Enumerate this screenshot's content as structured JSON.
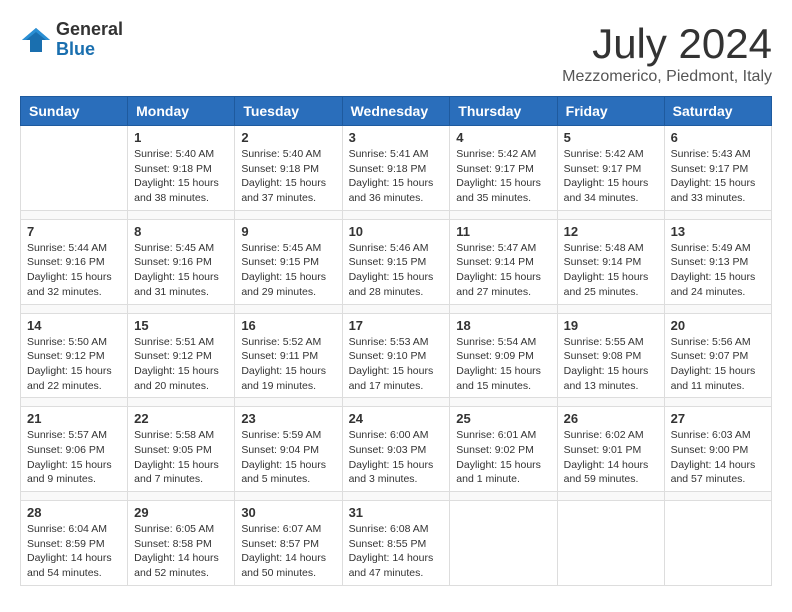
{
  "header": {
    "logo_general": "General",
    "logo_blue": "Blue",
    "month": "July 2024",
    "location": "Mezzomerico, Piedmont, Italy"
  },
  "columns": [
    "Sunday",
    "Monday",
    "Tuesday",
    "Wednesday",
    "Thursday",
    "Friday",
    "Saturday"
  ],
  "weeks": [
    [
      {
        "day": "",
        "text": ""
      },
      {
        "day": "1",
        "text": "Sunrise: 5:40 AM\nSunset: 9:18 PM\nDaylight: 15 hours\nand 38 minutes."
      },
      {
        "day": "2",
        "text": "Sunrise: 5:40 AM\nSunset: 9:18 PM\nDaylight: 15 hours\nand 37 minutes."
      },
      {
        "day": "3",
        "text": "Sunrise: 5:41 AM\nSunset: 9:18 PM\nDaylight: 15 hours\nand 36 minutes."
      },
      {
        "day": "4",
        "text": "Sunrise: 5:42 AM\nSunset: 9:17 PM\nDaylight: 15 hours\nand 35 minutes."
      },
      {
        "day": "5",
        "text": "Sunrise: 5:42 AM\nSunset: 9:17 PM\nDaylight: 15 hours\nand 34 minutes."
      },
      {
        "day": "6",
        "text": "Sunrise: 5:43 AM\nSunset: 9:17 PM\nDaylight: 15 hours\nand 33 minutes."
      }
    ],
    [
      {
        "day": "7",
        "text": "Sunrise: 5:44 AM\nSunset: 9:16 PM\nDaylight: 15 hours\nand 32 minutes."
      },
      {
        "day": "8",
        "text": "Sunrise: 5:45 AM\nSunset: 9:16 PM\nDaylight: 15 hours\nand 31 minutes."
      },
      {
        "day": "9",
        "text": "Sunrise: 5:45 AM\nSunset: 9:15 PM\nDaylight: 15 hours\nand 29 minutes."
      },
      {
        "day": "10",
        "text": "Sunrise: 5:46 AM\nSunset: 9:15 PM\nDaylight: 15 hours\nand 28 minutes."
      },
      {
        "day": "11",
        "text": "Sunrise: 5:47 AM\nSunset: 9:14 PM\nDaylight: 15 hours\nand 27 minutes."
      },
      {
        "day": "12",
        "text": "Sunrise: 5:48 AM\nSunset: 9:14 PM\nDaylight: 15 hours\nand 25 minutes."
      },
      {
        "day": "13",
        "text": "Sunrise: 5:49 AM\nSunset: 9:13 PM\nDaylight: 15 hours\nand 24 minutes."
      }
    ],
    [
      {
        "day": "14",
        "text": "Sunrise: 5:50 AM\nSunset: 9:12 PM\nDaylight: 15 hours\nand 22 minutes."
      },
      {
        "day": "15",
        "text": "Sunrise: 5:51 AM\nSunset: 9:12 PM\nDaylight: 15 hours\nand 20 minutes."
      },
      {
        "day": "16",
        "text": "Sunrise: 5:52 AM\nSunset: 9:11 PM\nDaylight: 15 hours\nand 19 minutes."
      },
      {
        "day": "17",
        "text": "Sunrise: 5:53 AM\nSunset: 9:10 PM\nDaylight: 15 hours\nand 17 minutes."
      },
      {
        "day": "18",
        "text": "Sunrise: 5:54 AM\nSunset: 9:09 PM\nDaylight: 15 hours\nand 15 minutes."
      },
      {
        "day": "19",
        "text": "Sunrise: 5:55 AM\nSunset: 9:08 PM\nDaylight: 15 hours\nand 13 minutes."
      },
      {
        "day": "20",
        "text": "Sunrise: 5:56 AM\nSunset: 9:07 PM\nDaylight: 15 hours\nand 11 minutes."
      }
    ],
    [
      {
        "day": "21",
        "text": "Sunrise: 5:57 AM\nSunset: 9:06 PM\nDaylight: 15 hours\nand 9 minutes."
      },
      {
        "day": "22",
        "text": "Sunrise: 5:58 AM\nSunset: 9:05 PM\nDaylight: 15 hours\nand 7 minutes."
      },
      {
        "day": "23",
        "text": "Sunrise: 5:59 AM\nSunset: 9:04 PM\nDaylight: 15 hours\nand 5 minutes."
      },
      {
        "day": "24",
        "text": "Sunrise: 6:00 AM\nSunset: 9:03 PM\nDaylight: 15 hours\nand 3 minutes."
      },
      {
        "day": "25",
        "text": "Sunrise: 6:01 AM\nSunset: 9:02 PM\nDaylight: 15 hours\nand 1 minute."
      },
      {
        "day": "26",
        "text": "Sunrise: 6:02 AM\nSunset: 9:01 PM\nDaylight: 14 hours\nand 59 minutes."
      },
      {
        "day": "27",
        "text": "Sunrise: 6:03 AM\nSunset: 9:00 PM\nDaylight: 14 hours\nand 57 minutes."
      }
    ],
    [
      {
        "day": "28",
        "text": "Sunrise: 6:04 AM\nSunset: 8:59 PM\nDaylight: 14 hours\nand 54 minutes."
      },
      {
        "day": "29",
        "text": "Sunrise: 6:05 AM\nSunset: 8:58 PM\nDaylight: 14 hours\nand 52 minutes."
      },
      {
        "day": "30",
        "text": "Sunrise: 6:07 AM\nSunset: 8:57 PM\nDaylight: 14 hours\nand 50 minutes."
      },
      {
        "day": "31",
        "text": "Sunrise: 6:08 AM\nSunset: 8:55 PM\nDaylight: 14 hours\nand 47 minutes."
      },
      {
        "day": "",
        "text": ""
      },
      {
        "day": "",
        "text": ""
      },
      {
        "day": "",
        "text": ""
      }
    ]
  ]
}
